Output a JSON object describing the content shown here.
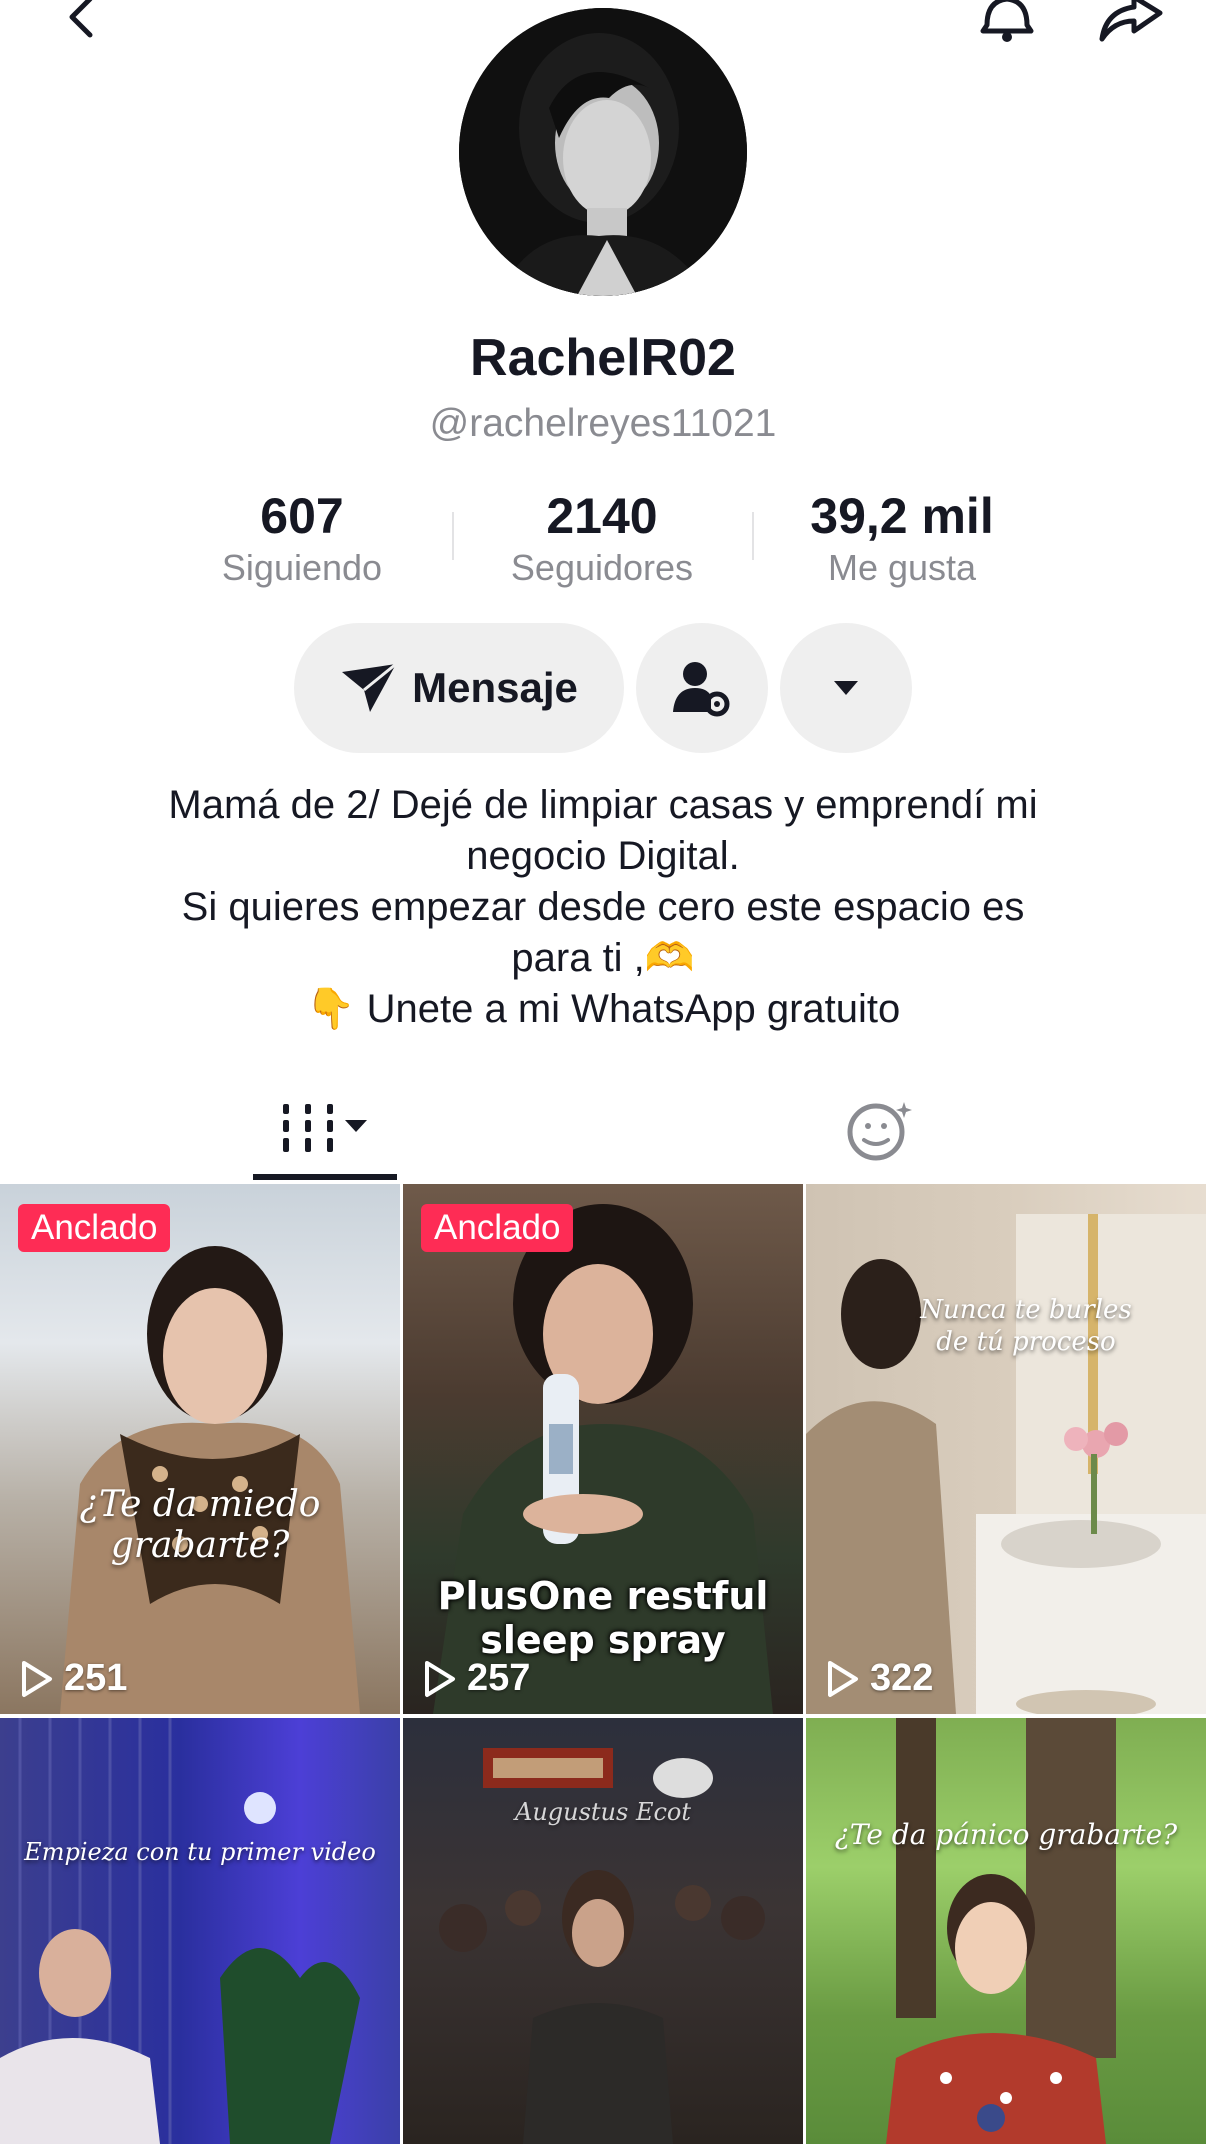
{
  "profile": {
    "username": "RachelR02",
    "handle": "@rachelreyes11021"
  },
  "stats": {
    "following": {
      "value": "607",
      "label": "Siguiendo"
    },
    "followers": {
      "value": "2140",
      "label": "Seguidores"
    },
    "likes": {
      "value": "39,2 mil",
      "label": "Me gusta"
    }
  },
  "actions": {
    "message_label": "Mensaje"
  },
  "bio": {
    "line1": "Mamá de 2/ Dejé de limpiar casas y emprendí mi",
    "line2": "negocio Digital.",
    "line3": "Si quieres empezar desde cero este espacio es",
    "line4": "para ti ,🫶",
    "line5": "👇 Unete a mi WhatsApp gratuito"
  },
  "videos": [
    {
      "pinned_label": "Anclado",
      "views": "251",
      "caption": "¿Te da miedo grabarte?"
    },
    {
      "pinned_label": "Anclado",
      "views": "257",
      "caption_line1": "PlusOne restful",
      "caption_line2": "sleep spray"
    },
    {
      "views": "322",
      "caption_line1": "Nunca te burles",
      "caption_line2": "de tú proceso"
    },
    {
      "caption": "Empieza con tu primer video"
    },
    {
      "caption": "Augustus Ecot"
    },
    {
      "caption": "¿Te da pánico grabarte?"
    }
  ],
  "colors": {
    "accent": "#fe2c55",
    "button_bg": "#efefef",
    "muted_text": "#8a8b91"
  },
  "icons": [
    "back-icon",
    "bell-icon",
    "share-icon",
    "send-icon",
    "user-settings-icon",
    "dropdown-icon",
    "grid-icon",
    "ai-face-icon",
    "play-icon"
  ]
}
